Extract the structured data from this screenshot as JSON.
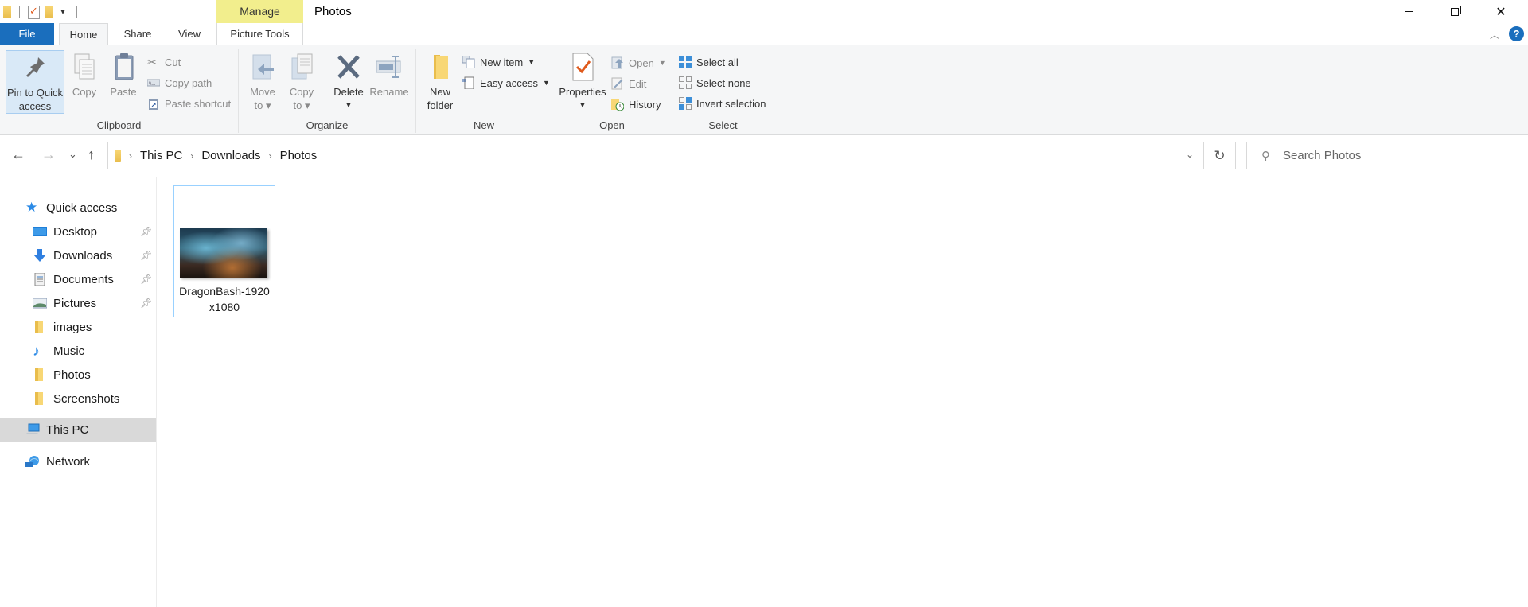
{
  "window": {
    "title": "Photos",
    "contextual_tab_group": "Manage",
    "controls": {
      "minimize": "—",
      "maximize": "restore",
      "close": "✕"
    }
  },
  "quick_access_toolbar": {
    "items": [
      "folder-icon",
      "properties-icon",
      "new-folder-icon"
    ],
    "customize": "▾"
  },
  "ribbon_tabs": {
    "file": "File",
    "home": "Home",
    "share": "Share",
    "view": "View",
    "picture_tools": "Picture Tools",
    "active": "Home"
  },
  "ribbon": {
    "clipboard": {
      "label": "Clipboard",
      "pin": "Pin to Quick access",
      "pin_line1": "Pin to Quick",
      "pin_line2": "access",
      "copy": "Copy",
      "paste": "Paste",
      "cut": "Cut",
      "copy_path": "Copy path",
      "paste_shortcut": "Paste shortcut"
    },
    "organize": {
      "label": "Organize",
      "move_to_1": "Move",
      "move_to_2": "to",
      "copy_to_1": "Copy",
      "copy_to_2": "to",
      "delete": "Delete",
      "rename": "Rename"
    },
    "new": {
      "label": "New",
      "new_folder_1": "New",
      "new_folder_2": "folder",
      "new_item": "New item",
      "easy_access": "Easy access"
    },
    "open": {
      "label": "Open",
      "properties": "Properties",
      "open": "Open",
      "edit": "Edit",
      "history": "History"
    },
    "select": {
      "label": "Select",
      "select_all": "Select all",
      "select_none": "Select none",
      "invert_selection": "Invert selection"
    }
  },
  "navigation": {
    "back": "←",
    "forward": "→",
    "recent": "⌄",
    "up": "↑",
    "breadcrumb": [
      "This PC",
      "Downloads",
      "Photos"
    ],
    "refresh": "↻",
    "search_placeholder": "Search Photos"
  },
  "sidebar": {
    "quick_access": "Quick access",
    "pinned": [
      {
        "label": "Desktop",
        "icon": "desktop-icon",
        "pinned": true
      },
      {
        "label": "Downloads",
        "icon": "downloads-icon",
        "pinned": true
      },
      {
        "label": "Documents",
        "icon": "documents-icon",
        "pinned": true
      },
      {
        "label": "Pictures",
        "icon": "pictures-icon",
        "pinned": true
      },
      {
        "label": "images",
        "icon": "folder-icon",
        "pinned": false
      },
      {
        "label": "Music",
        "icon": "music-icon",
        "pinned": false
      },
      {
        "label": "Photos",
        "icon": "folder-icon",
        "pinned": false
      },
      {
        "label": "Screenshots",
        "icon": "folder-icon",
        "pinned": false
      }
    ],
    "this_pc": "This PC",
    "network": "Network",
    "selected": "This PC"
  },
  "content": {
    "files": [
      {
        "name": "DragonBash-1920x1080",
        "type": "image",
        "selected": true
      }
    ]
  },
  "colors": {
    "accent": "#1a6ebd",
    "contextual_tab": "#f2ee8d",
    "selection_border": "#99d1ff",
    "sidebar_selected": "#d9d9d9",
    "ribbon_bg": "#f5f6f7"
  }
}
